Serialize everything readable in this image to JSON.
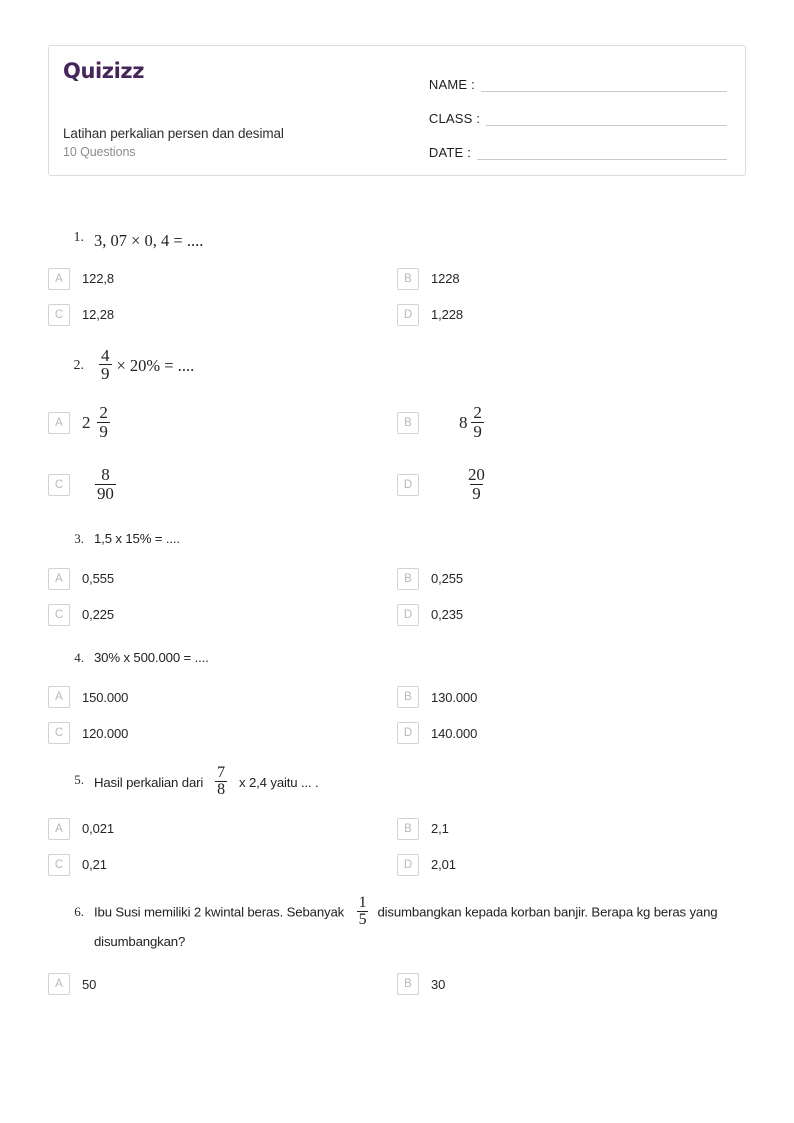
{
  "header": {
    "logo_text": "Quizizz",
    "logo_color": "#46255a",
    "quiz_title": "Latihan perkalian persen dan desimal",
    "quiz_subtitle": "10 Questions",
    "fields": [
      {
        "label": "NAME :",
        "value": ""
      },
      {
        "label": "CLASS :",
        "value": ""
      },
      {
        "label": "DATE  :",
        "value": ""
      }
    ]
  },
  "questions": [
    {
      "number": "1.",
      "style": "math",
      "text": "3, 07 × 0, 4 = ....",
      "options": [
        {
          "letter": "A",
          "text": "122,8"
        },
        {
          "letter": "B",
          "text": "1228"
        },
        {
          "letter": "C",
          "text": "12,28"
        },
        {
          "letter": "D",
          "text": "1,228"
        }
      ]
    },
    {
      "number": "2.",
      "style": "math-fraction",
      "frac_num": "4",
      "frac_den": "9",
      "text_after": "× 20% = ....",
      "options": [
        {
          "letter": "A",
          "kind": "mixed",
          "whole": "2",
          "num": "2",
          "den": "9"
        },
        {
          "letter": "B",
          "kind": "mixed",
          "whole": "8",
          "num": "2",
          "den": "9"
        },
        {
          "letter": "C",
          "kind": "frac",
          "num": "8",
          "den": "90"
        },
        {
          "letter": "D",
          "kind": "frac",
          "num": "20",
          "den": "9"
        }
      ]
    },
    {
      "number": "3.",
      "style": "plain",
      "text": "1,5 x 15% = ....",
      "options": [
        {
          "letter": "A",
          "text": "0,555"
        },
        {
          "letter": "B",
          "text": "0,255"
        },
        {
          "letter": "C",
          "text": "0,225"
        },
        {
          "letter": "D",
          "text": "0,235"
        }
      ]
    },
    {
      "number": "4.",
      "style": "plain",
      "text": "30% x 500.000 = ....",
      "options": [
        {
          "letter": "A",
          "text": "150.000"
        },
        {
          "letter": "B",
          "text": "130.000"
        },
        {
          "letter": "C",
          "text": "120.000"
        },
        {
          "letter": "D",
          "text": "140.000"
        }
      ]
    },
    {
      "number": "5.",
      "style": "text-with-fraction",
      "text_before": "Hasil perkalian dari",
      "frac_num": "7",
      "frac_den": "8",
      "text_after": "x 2,4 yaitu ... .",
      "options": [
        {
          "letter": "A",
          "text": "0,021"
        },
        {
          "letter": "B",
          "text": "2,1"
        },
        {
          "letter": "C",
          "text": "0,21"
        },
        {
          "letter": "D",
          "text": "2,01"
        }
      ]
    },
    {
      "number": "6.",
      "style": "text-with-fraction",
      "text_before": "Ibu Susi memiliki 2 kwintal beras. Sebanyak",
      "frac_num": "1",
      "frac_den": "5",
      "text_after": "disumbangkan kepada korban banjir. Berapa kg beras yang disumbangkan?",
      "options": [
        {
          "letter": "A",
          "text": "50"
        },
        {
          "letter": "B",
          "text": "30"
        }
      ]
    }
  ]
}
